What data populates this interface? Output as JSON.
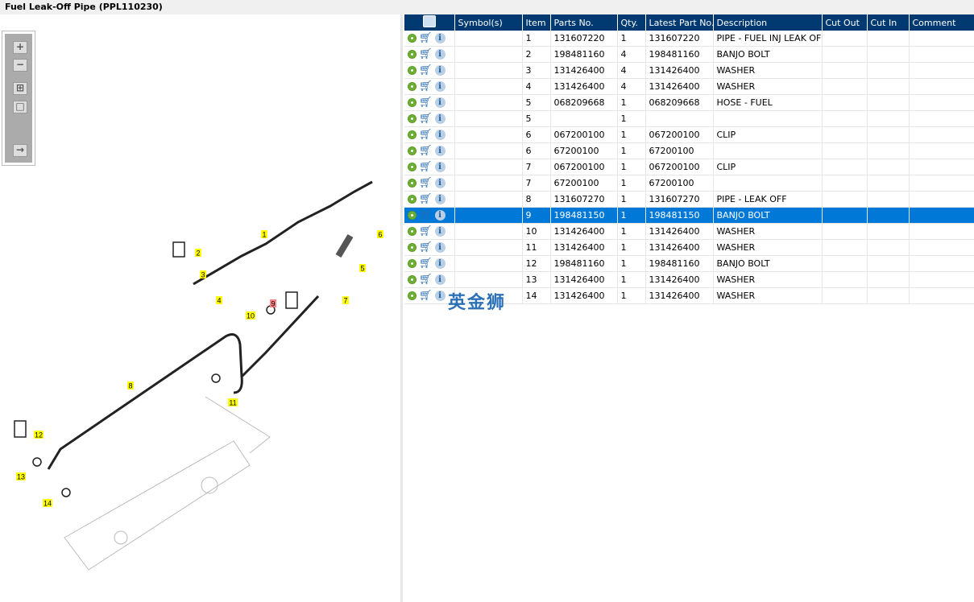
{
  "title": "Fuel Leak-Off Pipe (PPL110230)",
  "toolbar": {
    "zoom_in": "+",
    "zoom_out": "−",
    "fit": "⊞",
    "actual": "□",
    "export": "→"
  },
  "watermark": "英金狮",
  "columns": [
    "",
    "Symbol(s)",
    "Item",
    "Parts No.",
    "Qty.",
    "Latest Part No.",
    "Description",
    "Cut Out",
    "Cut In",
    "Comment"
  ],
  "rows": [
    [
      "",
      "1",
      "131607220",
      "1",
      "131607220",
      "PIPE - FUEL INJ LEAK OFF"
    ],
    [
      "",
      "2",
      "198481160",
      "4",
      "198481160",
      "BANJO BOLT"
    ],
    [
      "",
      "3",
      "131426400",
      "4",
      "131426400",
      "WASHER"
    ],
    [
      "",
      "4",
      "131426400",
      "4",
      "131426400",
      "WASHER"
    ],
    [
      "",
      "5",
      "068209668",
      "1",
      "068209668",
      "HOSE - FUEL"
    ],
    [
      "",
      "5",
      "",
      "1",
      "",
      ""
    ],
    [
      "",
      "6",
      "067200100",
      "1",
      "067200100",
      "CLIP"
    ],
    [
      "",
      "6",
      "67200100",
      "1",
      "67200100",
      ""
    ],
    [
      "",
      "7",
      "067200100",
      "1",
      "067200100",
      "CLIP"
    ],
    [
      "",
      "7",
      "67200100",
      "1",
      "67200100",
      ""
    ],
    [
      "",
      "8",
      "131607270",
      "1",
      "131607270",
      "PIPE - LEAK OFF"
    ],
    [
      "",
      "9",
      "198481150",
      "1",
      "198481150",
      "BANJO BOLT"
    ],
    [
      "",
      "10",
      "131426400",
      "1",
      "131426400",
      "WASHER"
    ],
    [
      "",
      "11",
      "131426400",
      "1",
      "131426400",
      "WASHER"
    ],
    [
      "",
      "12",
      "198481160",
      "1",
      "198481160",
      "BANJO BOLT"
    ],
    [
      "",
      "13",
      "131426400",
      "1",
      "131426400",
      "WASHER"
    ],
    [
      "",
      "14",
      "131426400",
      "1",
      "131426400",
      "WASHER"
    ]
  ],
  "selected_row": 11,
  "callouts": [
    "1",
    "2",
    "3",
    "4",
    "5",
    "6",
    "7",
    "8",
    "9",
    "10",
    "11",
    "12",
    "13",
    "14"
  ],
  "colors": {
    "header": "#003a70",
    "selected": "#0078d7",
    "callout": "#ffff00",
    "callout_highlight": "#ff8080"
  }
}
